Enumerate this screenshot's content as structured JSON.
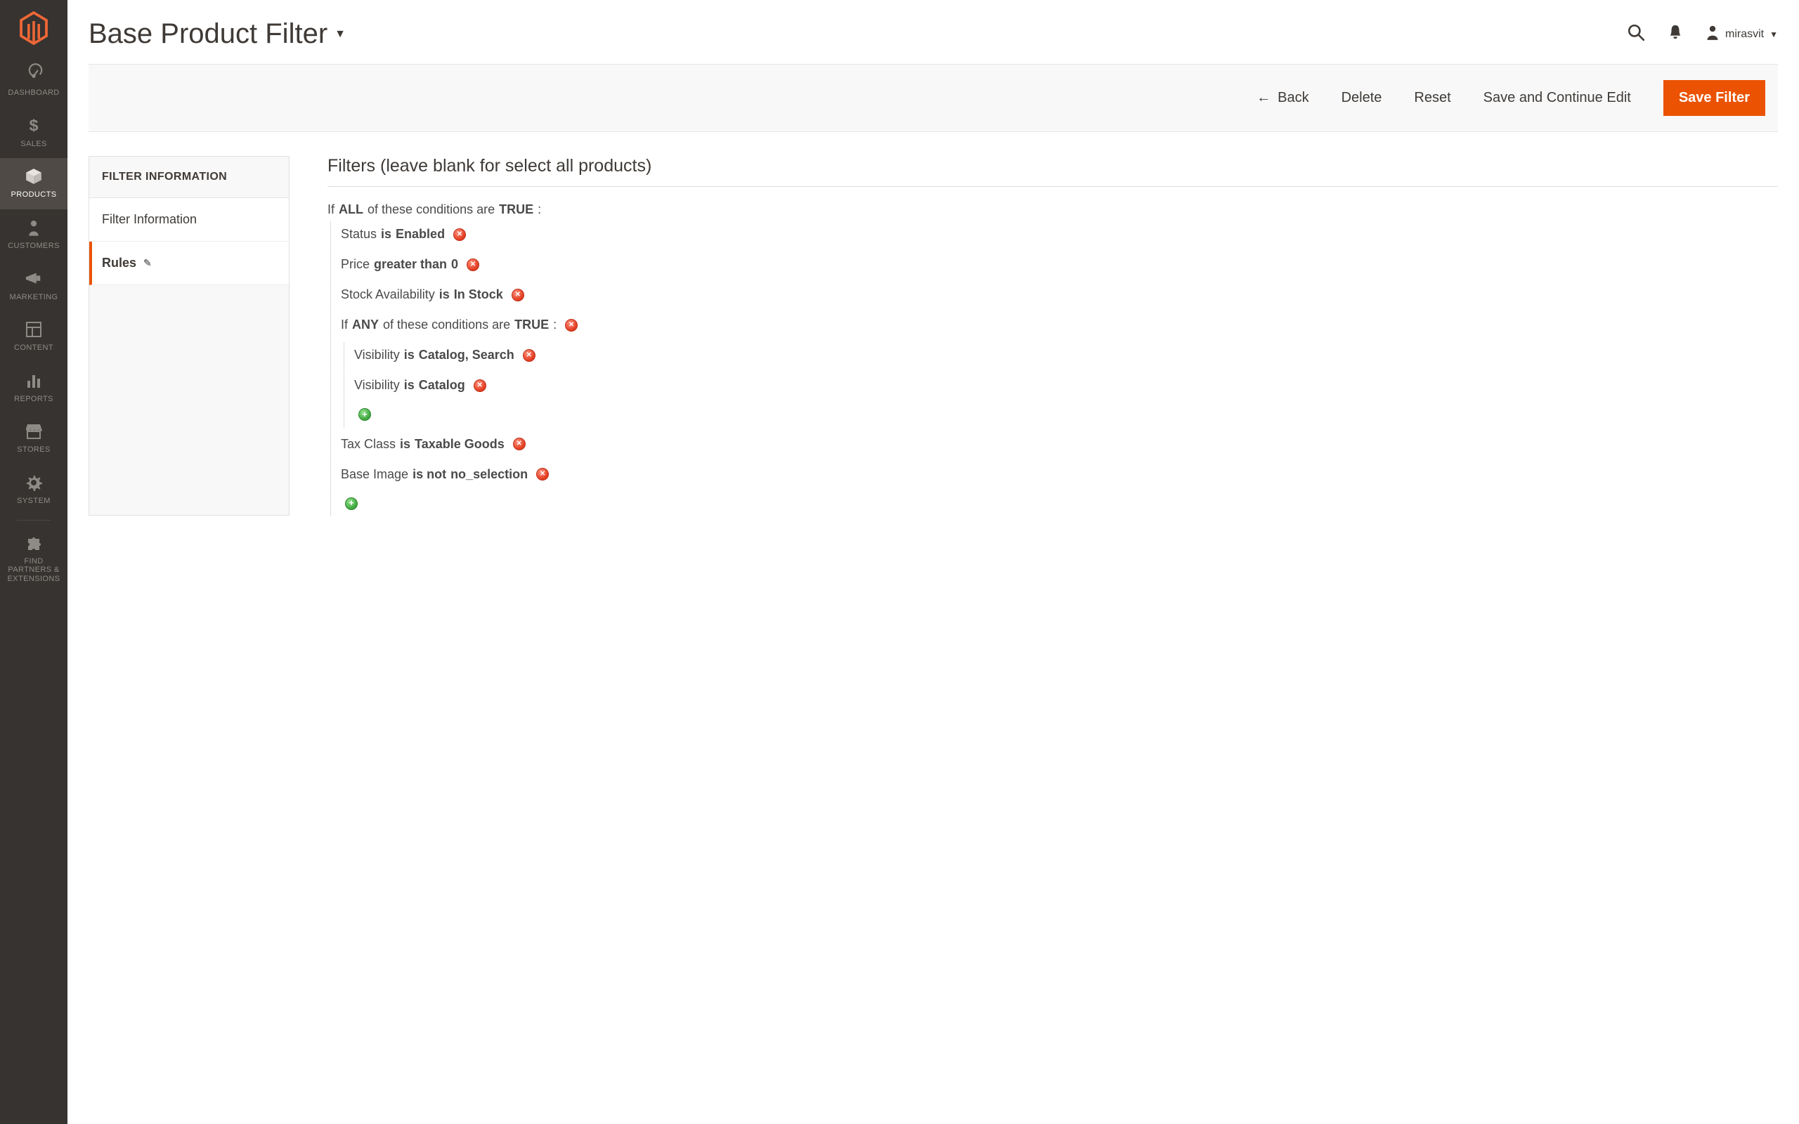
{
  "sidebar": {
    "items": [
      {
        "label": "DASHBOARD"
      },
      {
        "label": "SALES"
      },
      {
        "label": "PRODUCTS"
      },
      {
        "label": "CUSTOMERS"
      },
      {
        "label": "MARKETING"
      },
      {
        "label": "CONTENT"
      },
      {
        "label": "REPORTS"
      },
      {
        "label": "STORES"
      },
      {
        "label": "SYSTEM"
      },
      {
        "label": "FIND PARTNERS & EXTENSIONS"
      }
    ]
  },
  "header": {
    "page_title": "Base Product Filter",
    "username": "mirasvit"
  },
  "actions": {
    "back": "Back",
    "delete": "Delete",
    "reset": "Reset",
    "save_continue": "Save and Continue Edit",
    "save_filter": "Save Filter"
  },
  "tabs": {
    "panel_title": "FILTER INFORMATION",
    "items": [
      {
        "label": "Filter Information"
      },
      {
        "label": "Rules"
      }
    ]
  },
  "rules": {
    "heading": "Filters (leave blank for select all products)",
    "text": {
      "if": "If",
      "all": "ALL",
      "any": "ANY",
      "cond_are": "of these conditions are",
      "true": "TRUE",
      "colon": ":"
    },
    "conditions": [
      {
        "attr": "Status",
        "op": "is",
        "val": "Enabled"
      },
      {
        "attr": "Price",
        "op": "greater than",
        "val": "0"
      },
      {
        "attr": "Stock Availability",
        "op": "is",
        "val": "In Stock"
      },
      {
        "attr": "Tax Class",
        "op": "is",
        "val": "Taxable Goods"
      },
      {
        "attr": "Base Image",
        "op": "is not",
        "val": "no_selection"
      }
    ],
    "nested_conditions": [
      {
        "attr": "Visibility",
        "op": "is",
        "val": "Catalog, Search"
      },
      {
        "attr": "Visibility",
        "op": "is",
        "val": "Catalog"
      }
    ]
  }
}
